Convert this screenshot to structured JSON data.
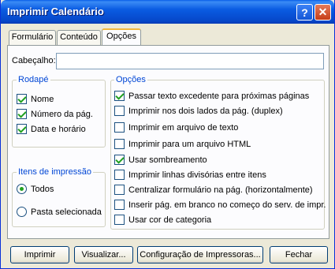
{
  "window": {
    "title": "Imprimir Calendário",
    "help_glyph": "?",
    "close_glyph": "✕"
  },
  "tabs": [
    {
      "label": "Formulário"
    },
    {
      "label": "Conteúdo"
    },
    {
      "label": "Opções",
      "active": true
    }
  ],
  "header": {
    "label": "Cabeçalho:",
    "value": ""
  },
  "rodape": {
    "title": "Rodapé",
    "items": [
      {
        "label": "Nome",
        "checked": true
      },
      {
        "label": "Número da pág.",
        "checked": true
      },
      {
        "label": "Data e horário",
        "checked": true
      }
    ]
  },
  "itens_impressao": {
    "title": "Itens de impressão",
    "items": [
      {
        "label": "Todos",
        "selected": true
      },
      {
        "label": "Pasta selecionada",
        "selected": false
      }
    ]
  },
  "opcoes": {
    "title": "Opções",
    "items": [
      {
        "label": "Passar texto excedente para próximas páginas",
        "checked": true
      },
      {
        "label": "Imprimir nos dois lados da pág. (duplex)",
        "checked": false
      },
      {
        "label": "Imprimir em arquivo de texto",
        "checked": false
      },
      {
        "label": "Imprimir para um arquivo HTML",
        "checked": false
      },
      {
        "label": "Usar sombreamento",
        "checked": true
      },
      {
        "label": "Imprimir linhas divisórias entre itens",
        "checked": false
      },
      {
        "label": "Centralizar formulário na pág. (horizontalmente)",
        "checked": false
      },
      {
        "label": "Inserir pág. em branco no começo do serv. de impr.",
        "checked": false
      },
      {
        "label": "Usar cor de categoria",
        "checked": false
      }
    ]
  },
  "buttons": {
    "imprimir": "Imprimir",
    "visualizar": "Visualizar...",
    "config": "Configuração de Impressoras...",
    "fechar": "Fechar"
  }
}
